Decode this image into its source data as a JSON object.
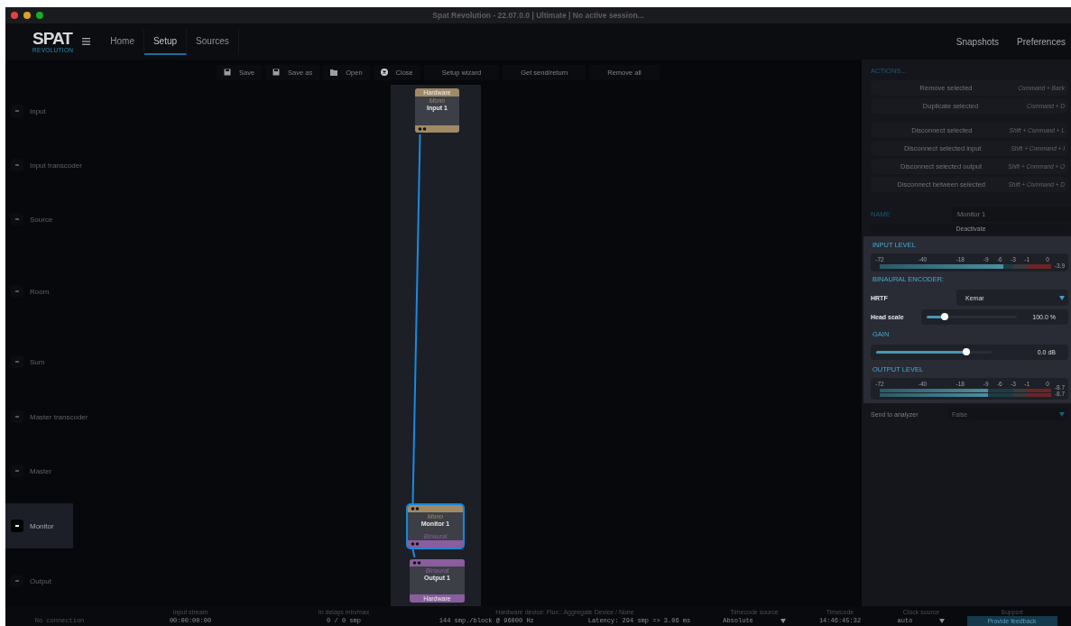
{
  "window": {
    "title": "Spat Revolution - 22.07.0.0 | Ultimate | No active session..."
  },
  "logo": {
    "name": "SPAT",
    "tagline": "REVOLUTION"
  },
  "tabs": [
    {
      "label": "Home",
      "selected": false
    },
    {
      "label": "Setup",
      "selected": true
    },
    {
      "label": "Sources",
      "selected": false
    }
  ],
  "nav_right": [
    "Snapshots",
    "Preferences"
  ],
  "toolbar": [
    {
      "label": "Save",
      "kind": "save"
    },
    {
      "label": "Save as",
      "kind": "save"
    },
    {
      "label": "Open",
      "kind": "open"
    },
    {
      "label": "Close",
      "kind": "close"
    },
    {
      "label": "Setup wizard",
      "kind": "text"
    },
    {
      "label": "Get send/return",
      "kind": "text"
    },
    {
      "label": "Remove all",
      "kind": "text"
    }
  ],
  "lanes": [
    {
      "label": "Input",
      "selected": false
    },
    {
      "label": "Input transcoder",
      "selected": false
    },
    {
      "label": "Source",
      "selected": false
    },
    {
      "label": "Room",
      "selected": false
    },
    {
      "label": "Sum",
      "selected": false
    },
    {
      "label": "Master transcoder",
      "selected": false
    },
    {
      "label": "Master",
      "selected": false
    },
    {
      "label": "Monitor",
      "selected": true
    },
    {
      "label": "Output",
      "selected": false
    }
  ],
  "nodes": [
    {
      "name": "Input 1",
      "selected": false,
      "top": {
        "kind": "mono",
        "label": "Hardware"
      },
      "input_format": "Mono",
      "bottom": {
        "kind": "mono"
      }
    },
    {
      "name": "Monitor 1",
      "selected": true,
      "top": {
        "kind": "mono"
      },
      "input_format": "Mono",
      "output_format": "Binaural",
      "bottom": {
        "kind": "binaural"
      }
    },
    {
      "name": "Output 1",
      "selected": false,
      "top": {
        "kind": "binaural"
      },
      "input_format": "Binaural",
      "bottom": {
        "kind": "binaural",
        "label": "Hardware"
      }
    }
  ],
  "panel": {
    "actions_title": "ACTIONS...",
    "action_groups": [
      [
        {
          "label": "Remove selected",
          "shortcut": "Command + Back"
        },
        {
          "label": "Duplicate selected",
          "shortcut": "Command + D"
        }
      ],
      [
        {
          "label": "Disconnect selected",
          "shortcut": "Shift + Command + L"
        },
        {
          "label": "Disconnect selected input",
          "shortcut": "Shift + Command + I"
        },
        {
          "label": "Disconnect selected output",
          "shortcut": "Shift + Command + O"
        },
        {
          "label": "Disconnect between selected",
          "shortcut": "Shift + Command + D"
        }
      ]
    ],
    "name_label": "NAME",
    "name_value": "Monitor 1",
    "deactivate": "Deactivate",
    "input_level": {
      "title": "INPUT LEVEL",
      "ticks": [
        "-72",
        "-40",
        "-18",
        "-9",
        "-6",
        "-3",
        "-1",
        "0"
      ],
      "channels": [
        {
          "level": 0.72,
          "reading": "-3.9"
        }
      ]
    },
    "encoder_title": "BINAURAL ENCODER:",
    "hrtf": {
      "label": "HRTF",
      "value": "Kemar"
    },
    "head_scale": {
      "label": "Head scale",
      "level": 0.2,
      "reading": "100.0 %"
    },
    "gain": {
      "title": "GAIN",
      "level": 0.78,
      "reading": "0.0 dB"
    },
    "output_level": {
      "title": "OUTPUT LEVEL",
      "ticks": [
        "-72",
        "-40",
        "-18",
        "-9",
        "-6",
        "-3",
        "-1",
        "0"
      ],
      "channels": [
        {
          "level": 0.63,
          "reading": "-8.7"
        },
        {
          "level": 0.63,
          "reading": "-8.7"
        }
      ]
    },
    "analyzer": {
      "label": "Send to analyzer",
      "value": "False"
    }
  },
  "status_bar": [
    {
      "values": [
        "No connection"
      ],
      "kind": "text"
    },
    {
      "header": "Input stream",
      "values": [
        "00:00:00:00"
      ],
      "kind": "text"
    },
    {
      "header": "In delays min/max",
      "values": [
        "0 / 0 smp"
      ],
      "kind": "text"
    },
    {
      "header": "Hardware device: Flux:: Aggregate Device / None",
      "values": [
        "144 smp./block @ 96000 Hz",
        "Latency: 294 smp => 3.06 ms"
      ],
      "kind": "text"
    },
    {
      "header": "Timecode source",
      "values": [
        "Absolute"
      ],
      "kind": "dropdown"
    },
    {
      "header": "Timecode",
      "values": [
        "14:46:45:32"
      ],
      "kind": "text"
    },
    {
      "header": "Clock source",
      "values": [
        "auto"
      ],
      "kind": "dropdown"
    },
    {
      "header": "Support",
      "values": [
        "Provide feedback"
      ],
      "kind": "button"
    }
  ]
}
